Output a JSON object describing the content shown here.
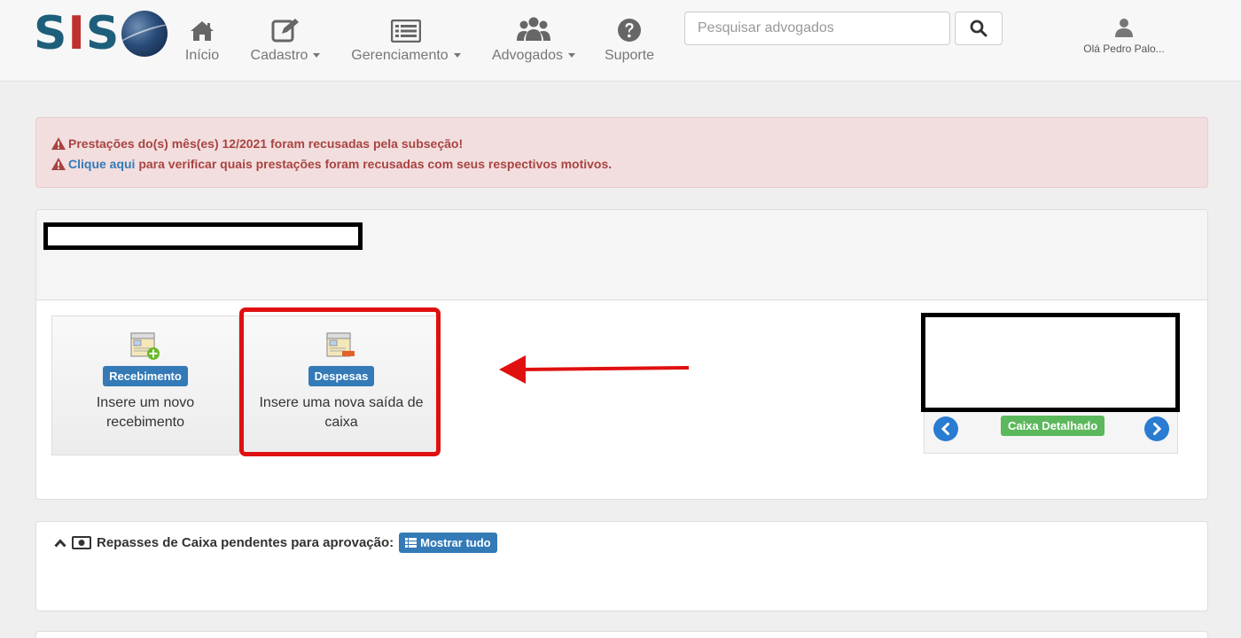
{
  "brand": {
    "logo_letters": [
      "S",
      "I",
      "S"
    ]
  },
  "nav": {
    "items": [
      {
        "label": "Início",
        "icon": "home-icon"
      },
      {
        "label": "Cadastro",
        "icon": "edit-icon"
      },
      {
        "label": "Gerenciamento",
        "icon": "list-icon"
      },
      {
        "label": "Advogados",
        "icon": "users-icon"
      },
      {
        "label": "Suporte",
        "icon": "help-icon"
      }
    ],
    "search_placeholder": "Pesquisar advogados",
    "user_greeting": "Olá Pedro Palo..."
  },
  "alert": {
    "line1": "Prestações do(s) mês(es) 12/2021 foram recusadas pela subseção!",
    "link_text": "Clique aqui",
    "line2_rest": " para verificar quais prestações foram recusadas com seus respectivos motivos."
  },
  "actions": {
    "recebimento": {
      "badge": "Recebimento",
      "description": "Insere um novo recebimento"
    },
    "despesas": {
      "badge": "Despesas",
      "description": "Insere uma nova saída de caixa"
    }
  },
  "carousel": {
    "button_label": "Caixa Detalhado"
  },
  "repasses": {
    "title": "Repasses de Caixa pendentes para aprovação:",
    "show_all_label": "Mostrar tudo"
  },
  "colors": {
    "primary": "#337ab7",
    "success": "#5cb85c",
    "alert_bg": "#f2dede",
    "alert_text": "#a94442",
    "annotation_red": "#e01010"
  }
}
